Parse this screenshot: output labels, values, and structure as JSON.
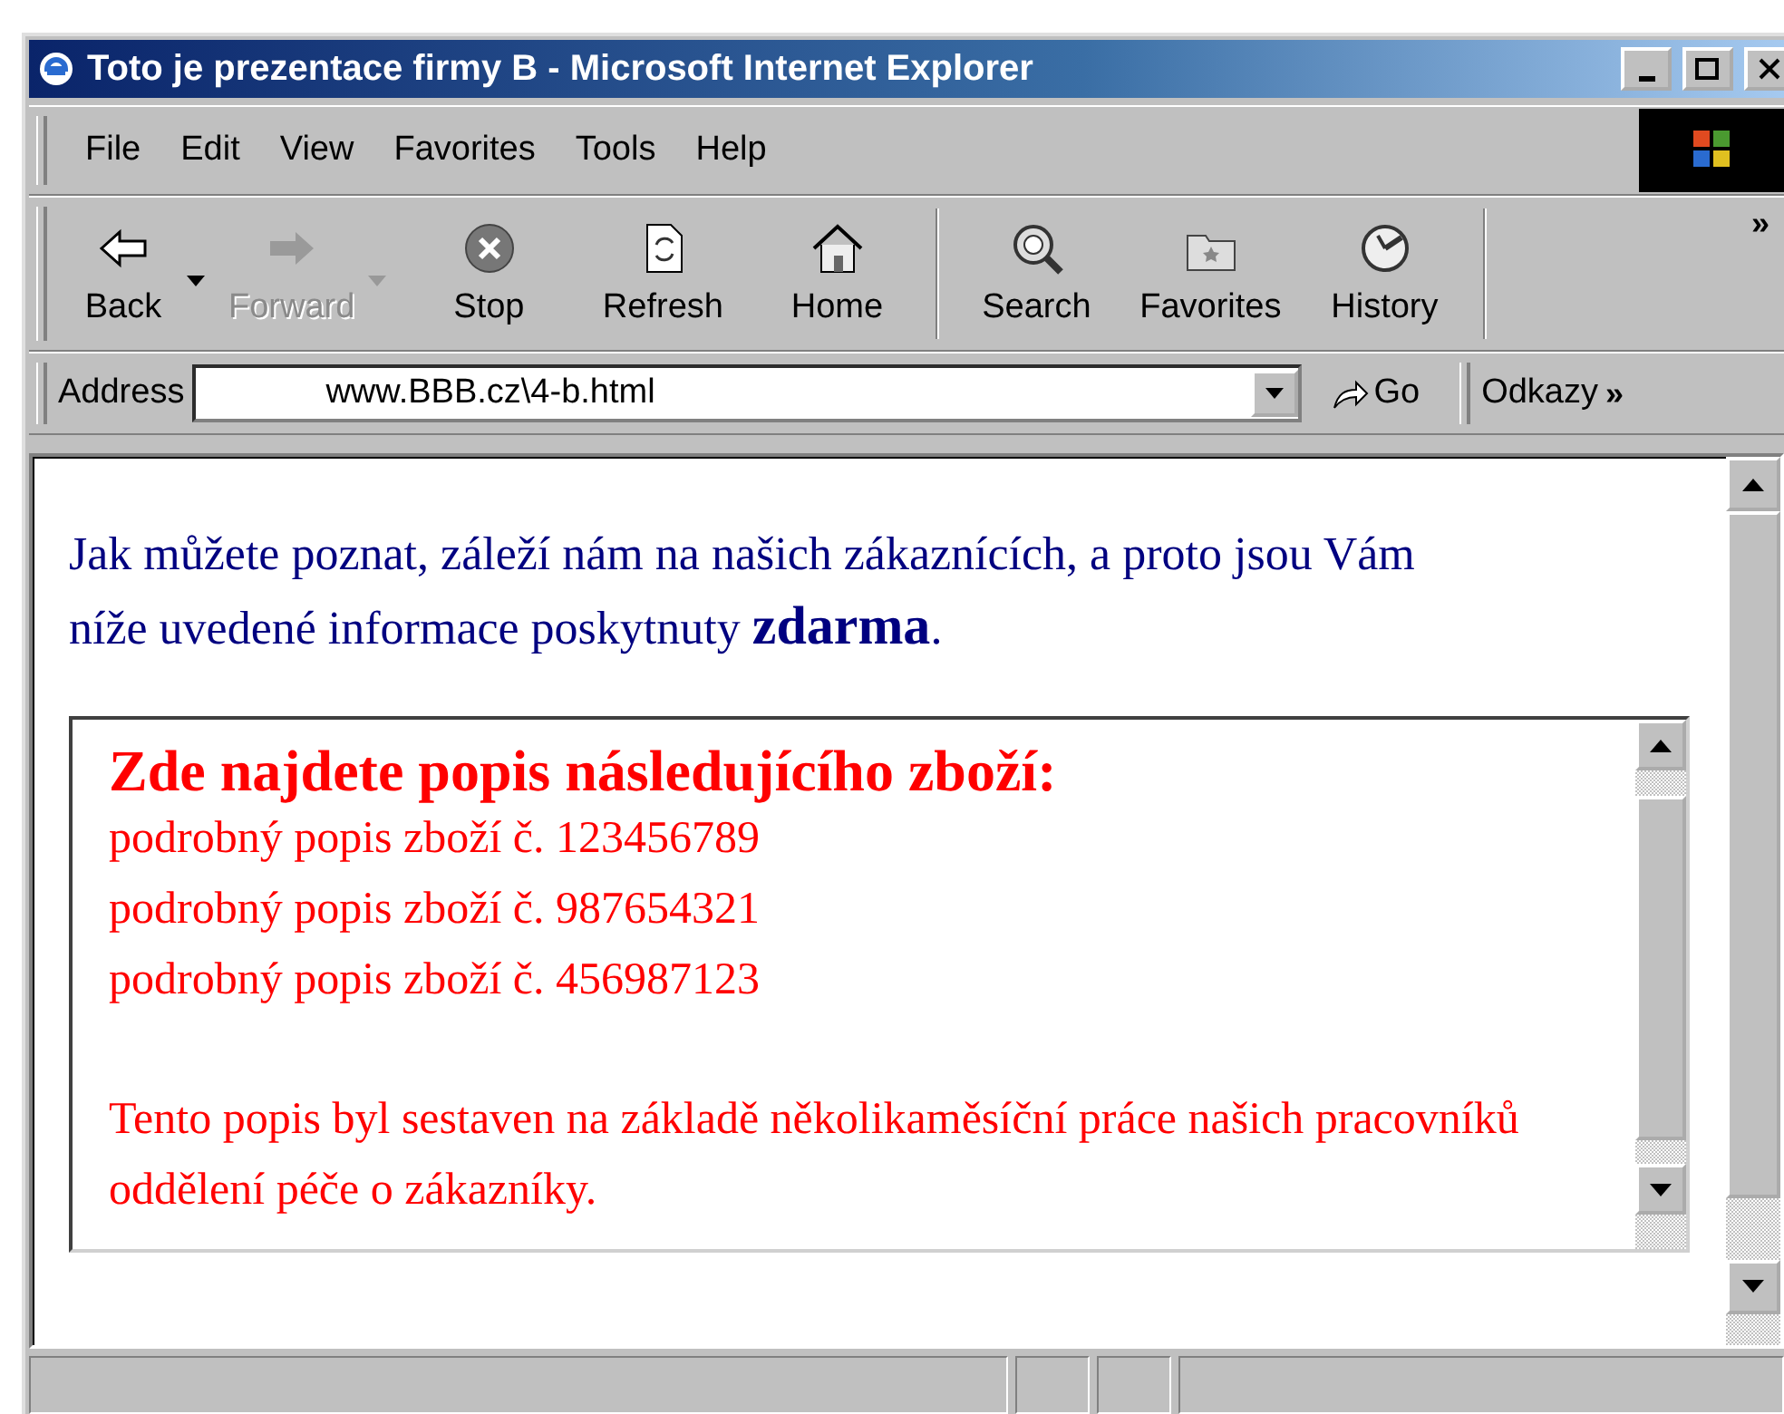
{
  "window": {
    "title": "Toto je prezentace firmy B - Microsoft Internet Explorer"
  },
  "menu": [
    "File",
    "Edit",
    "View",
    "Favorites",
    "Tools",
    "Help"
  ],
  "toolbar": {
    "buttons": [
      {
        "label": "Back",
        "kind": "back",
        "disabled": false,
        "dropdown": true
      },
      {
        "label": "Forward",
        "kind": "forward",
        "disabled": true,
        "dropdown": true
      },
      {
        "label": "Stop",
        "kind": "stop",
        "disabled": false,
        "dropdown": false
      },
      {
        "label": "Refresh",
        "kind": "refresh",
        "disabled": false,
        "dropdown": false
      },
      {
        "label": "Home",
        "kind": "home",
        "disabled": false,
        "dropdown": false
      },
      {
        "label": "Search",
        "kind": "search",
        "disabled": false,
        "dropdown": false
      },
      {
        "label": "Favorites",
        "kind": "favorites",
        "disabled": false,
        "dropdown": false
      },
      {
        "label": "History",
        "kind": "history",
        "disabled": false,
        "dropdown": false
      }
    ],
    "chevron": "»"
  },
  "address_bar": {
    "label": "Address",
    "value": "www.BBB.cz\\4-b.html",
    "go": "Go",
    "links": "Odkazy",
    "chevron": "»"
  },
  "page": {
    "intro": "Jak můžete poznat, záleží nám na našich zákaznících, a proto jsou Vám níže uvedené informace poskytnuty **zdarma**.",
    "frame": {
      "heading": "Zde najdete popis následujícího zboží:",
      "items": [
        "podrobný popis zboží č. 123456789",
        "podrobný popis zboží č. 987654321",
        "podrobný popis zboží č. 456987123"
      ],
      "note": "Tento popis byl sestaven na základě několikaměsíční práce našich pracovníků oddělení péče o zákazníky."
    }
  }
}
